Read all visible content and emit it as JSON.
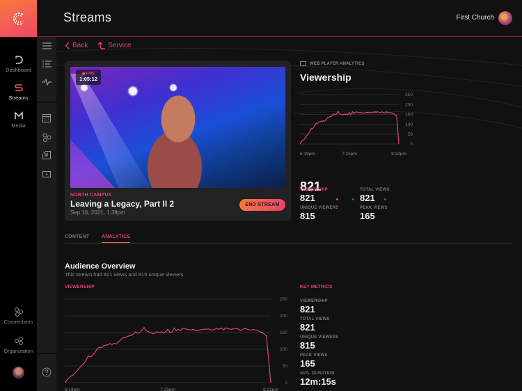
{
  "app": {
    "title": "Streams",
    "organization": "First Church"
  },
  "colors": {
    "accent": "#e0456a",
    "accent_orange": "#f5793f",
    "background": "#0f0f0f"
  },
  "nav": {
    "items": [
      {
        "label": "Dashboard",
        "icon": "dashboard-icon"
      },
      {
        "label": "Streams",
        "icon": "streams-icon",
        "active": true
      },
      {
        "label": "Media",
        "icon": "media-icon"
      },
      {
        "label": "Connections",
        "icon": "connections-icon"
      },
      {
        "label": "Organization",
        "icon": "organization-icon"
      }
    ]
  },
  "sub_nav": {
    "icons": [
      "menu-icon",
      "list-icon",
      "pulse-icon",
      "calendar-icon",
      "connections-icon",
      "import-icon",
      "video-icon",
      "help-icon"
    ]
  },
  "breadcrumb": {
    "back": "Back",
    "parent": "Service"
  },
  "stream": {
    "live_label": "LIVE",
    "live_time": "1:05:12",
    "campus": "NORTH CAMPUS",
    "title": "Leaving a Legacy, Part II 2",
    "date": "Sep 16, 2021, 1:39pm",
    "end_button": "END STREAM"
  },
  "web_player": {
    "section_label": "WEB PLAYER ANALYTICS",
    "heading": "Viewership",
    "big_value": "821",
    "page_dots": 4,
    "active_dot": 0,
    "stats": [
      {
        "label": "VIEWERSHIP",
        "value": "821",
        "highlight": true
      },
      {
        "label": "TOTAL VIEWS",
        "value": "821"
      },
      {
        "label": "UNIQUE VIEWERS",
        "value": "815"
      },
      {
        "label": "PEAK VIEWS",
        "value": "165"
      }
    ]
  },
  "tabs": [
    {
      "label": "CONTENT",
      "active": false
    },
    {
      "label": "ANALYTICS",
      "active": true
    }
  ],
  "overview": {
    "title": "Audience Overview",
    "subtitle": "This stream had 821 views and 815 unique viewers.",
    "chart_label": "VIEWERSHIP",
    "metrics_label": "KEY METRICS",
    "metrics": [
      {
        "label": "VIEWERSHIP",
        "value": "821"
      },
      {
        "label": "TOTAL VIEWS",
        "value": "821"
      },
      {
        "label": "UNIQUE VIEWERS",
        "value": "815"
      },
      {
        "label": "PEAK VIEWS",
        "value": "165"
      },
      {
        "label": "AVG. DURATION",
        "value": "12m:15s"
      }
    ]
  },
  "chart_data": {
    "type": "line",
    "title": "Viewership",
    "xlabel": "",
    "ylabel": "",
    "x_tick_labels": [
      "6:19pm",
      "7:25pm",
      "8:32pm"
    ],
    "y_ticks": [
      0,
      50,
      100,
      150,
      200,
      250
    ],
    "ylim": [
      0,
      250
    ],
    "grid": true,
    "series": [
      {
        "name": "Viewership",
        "color": "#e0456a",
        "values": [
          0,
          8,
          15,
          20,
          23,
          30,
          38,
          45,
          52,
          58,
          68,
          80,
          77,
          82,
          90,
          100,
          106,
          105,
          110,
          112,
          113,
          117,
          114,
          118,
          116,
          122,
          128,
          134,
          135,
          138,
          140,
          141,
          146,
          152,
          148,
          150,
          157,
          165,
          155,
          152,
          150,
          147,
          148,
          152,
          150,
          152,
          148,
          152,
          160,
          150,
          152,
          164,
          155,
          160,
          156,
          163,
          161,
          160,
          158,
          158,
          160,
          156,
          155,
          158,
          159,
          160,
          160,
          161,
          158,
          158,
          160,
          162,
          160,
          164,
          158,
          164,
          162,
          160,
          160,
          162,
          162,
          160,
          156,
          160,
          163,
          160,
          158,
          158,
          159,
          158,
          156,
          152,
          150,
          145,
          140,
          70,
          0
        ]
      }
    ]
  }
}
